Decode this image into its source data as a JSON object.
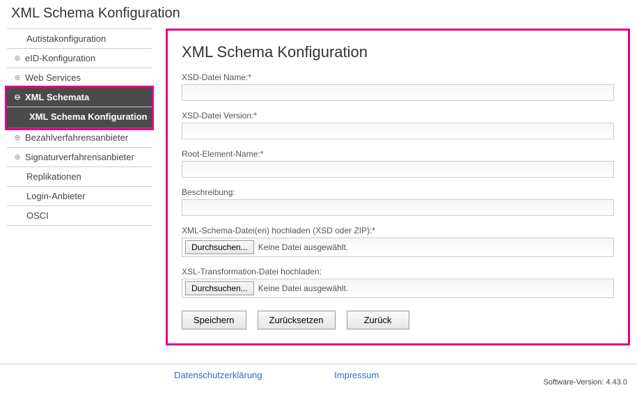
{
  "page_title": "XML Schema Konfiguration",
  "sidebar": {
    "items": [
      {
        "label": "Autistakonfiguration",
        "icon": ""
      },
      {
        "label": "eID-Konfiguration",
        "icon": "⊕"
      },
      {
        "label": "Web Services",
        "icon": "⊕"
      },
      {
        "label": "XML Schemata",
        "icon": "⊖"
      },
      {
        "label": "XML Schema Konfiguration",
        "icon": ""
      },
      {
        "label": "Bezahlverfahrensanbieter",
        "icon": "⊕"
      },
      {
        "label": "Signaturverfahrensanbieter",
        "icon": "⊕"
      },
      {
        "label": "Replikationen",
        "icon": ""
      },
      {
        "label": "Login-Anbieter",
        "icon": ""
      },
      {
        "label": "OSCI",
        "icon": ""
      }
    ]
  },
  "panel": {
    "title": "XML Schema Konfiguration",
    "labels": {
      "xsd_name": "XSD-Datei Name:*",
      "xsd_version": "XSD-Datei Version:*",
      "root_element": "Root-Element-Name:*",
      "description": "Beschreibung:",
      "upload_xsd": "XML-Schema-Datei(en) hochladen (XSD oder ZIP):*",
      "upload_xsl": "XSL-Transformation-Datei hochladen:"
    },
    "values": {
      "xsd_name": "",
      "xsd_version": "",
      "root_element": "",
      "description": ""
    },
    "file": {
      "browse": "Durchsuchen...",
      "none": "Keine Datei ausgewählt."
    },
    "buttons": {
      "save": "Speichern",
      "reset": "Zurücksetzen",
      "back": "Zurück"
    }
  },
  "footer": {
    "privacy": "Datenschutzerklärung",
    "imprint": "Impressum",
    "version": "Software-Version: 4.43.0"
  }
}
